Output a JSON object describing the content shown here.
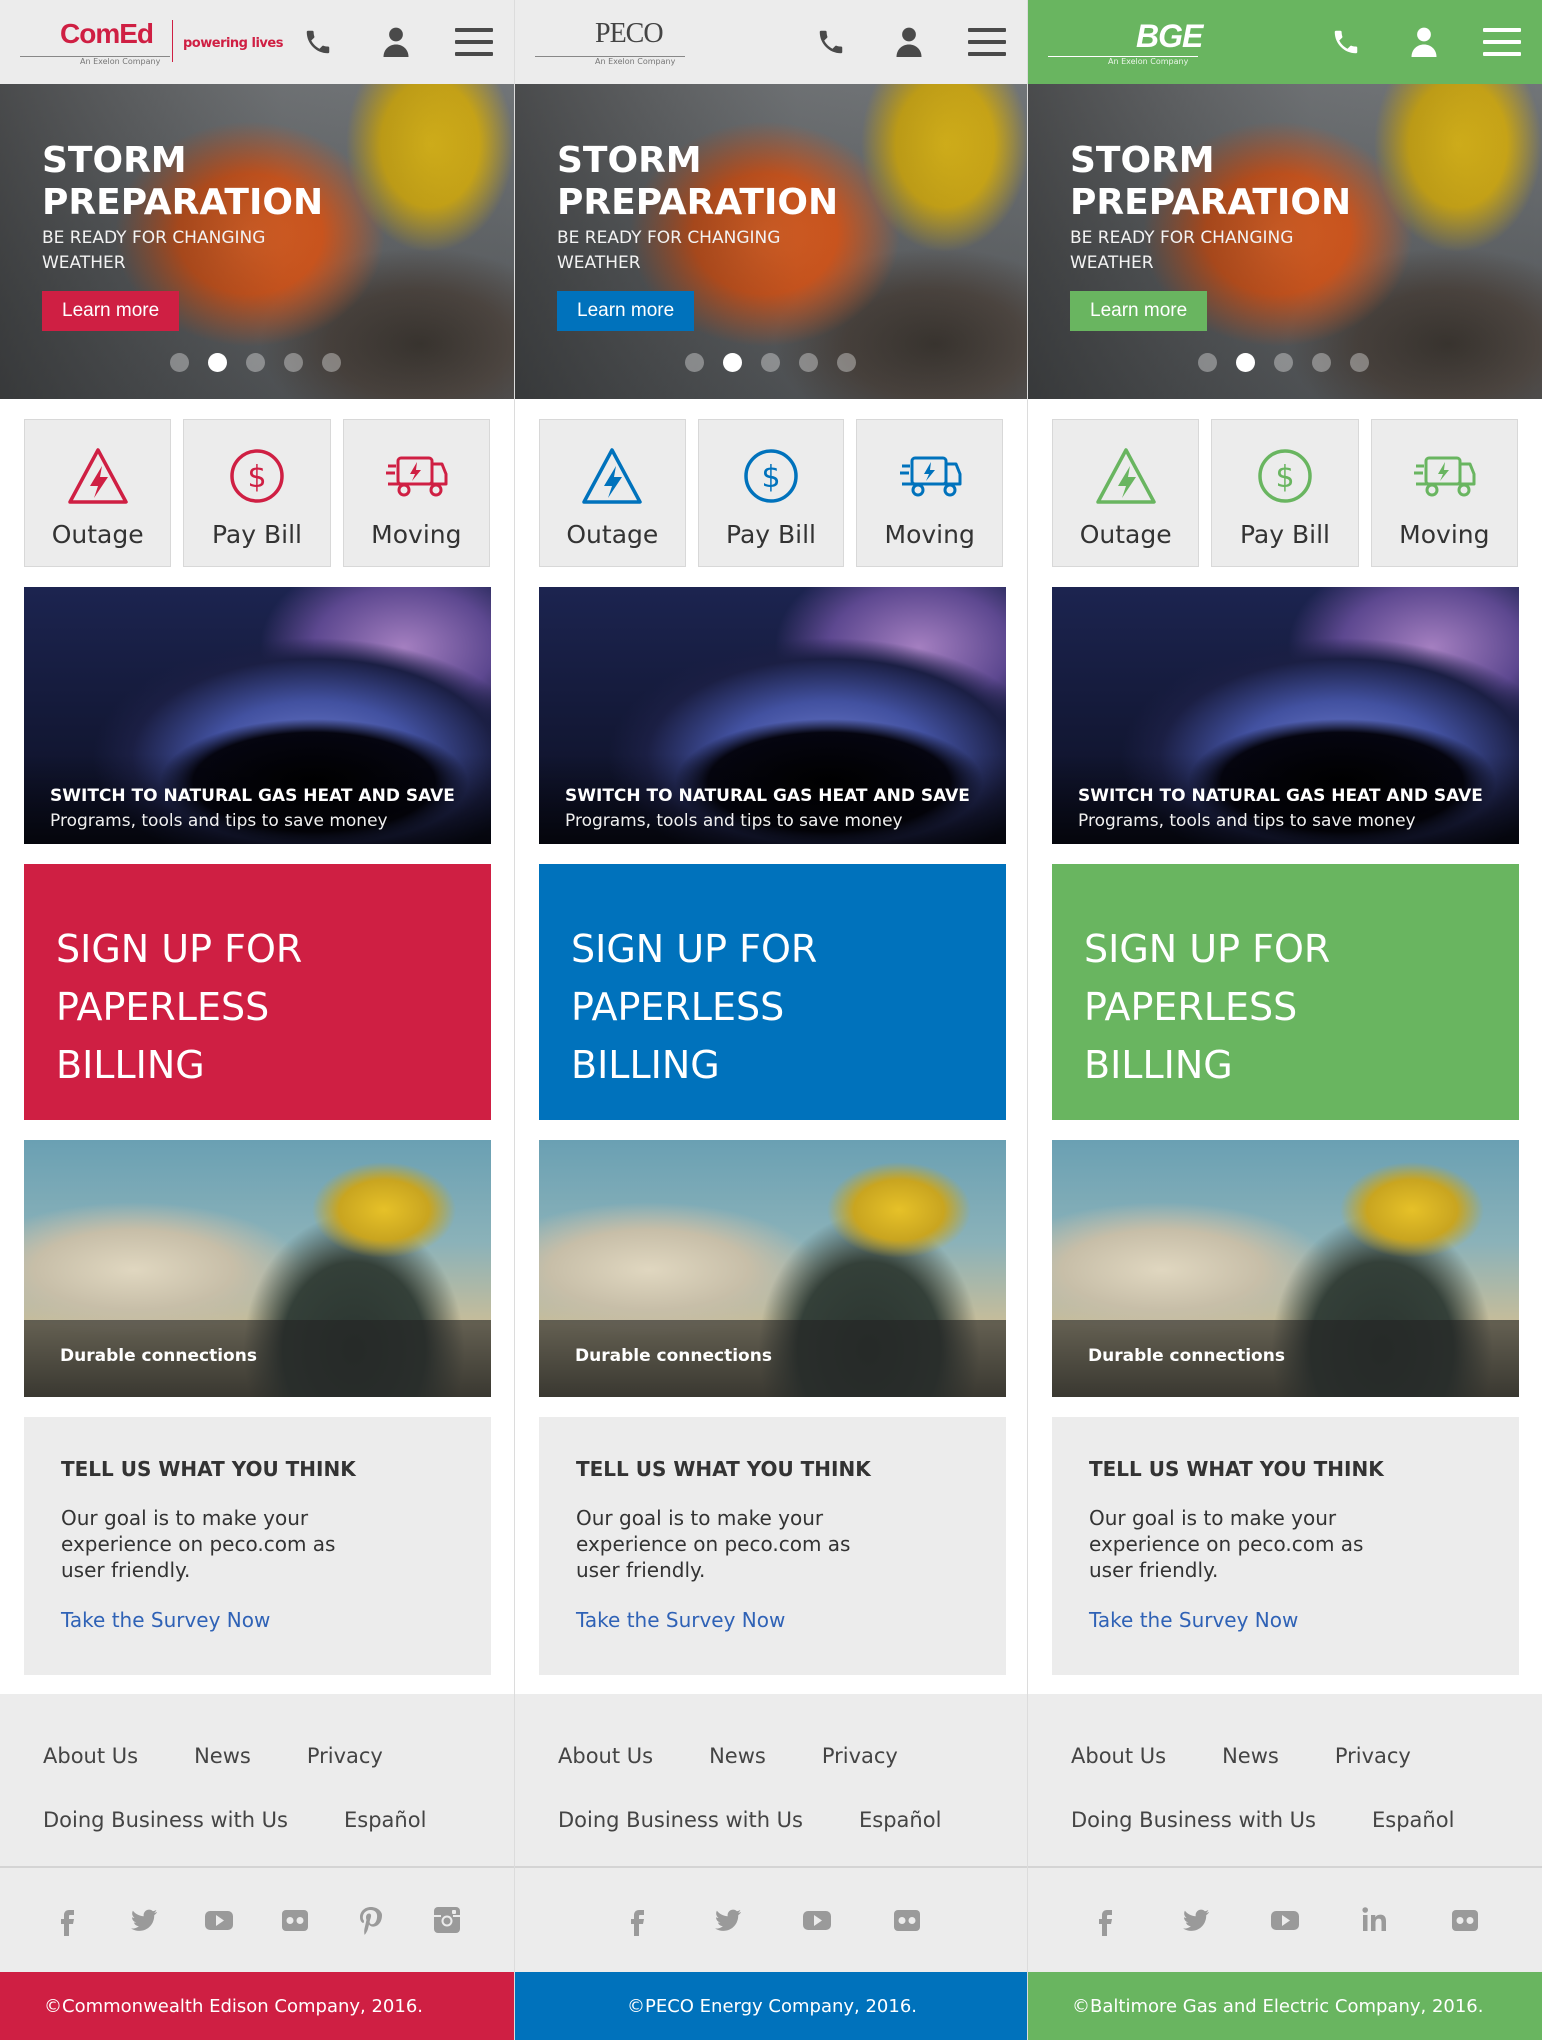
{
  "columns": [
    {
      "brand": "ComEd",
      "logo_sub": "An Exelon Company",
      "tagline": "powering lives",
      "accent": "#cf1f43",
      "header_bg": "#ececec",
      "hero": {
        "title": "STORM PREPARATION",
        "subtitle": "BE READY FOR CHANGING WEATHER",
        "button": "Learn more"
      },
      "carousel": {
        "count": 5,
        "active": 2
      },
      "tiles": [
        {
          "icon": "outage-bolt-icon",
          "label": "Outage"
        },
        {
          "icon": "dollar-icon",
          "label": "Pay Bill"
        },
        {
          "icon": "moving-truck-icon",
          "label": "Moving"
        }
      ],
      "gas_card": {
        "title": "SWITCH TO NATURAL GAS HEAT AND SAVE",
        "subtitle": "Programs, tools and tips to save money"
      },
      "paperless": {
        "text": "SIGN UP FOR PAPERLESS BILLING"
      },
      "worker_card": {
        "text": "Durable connections"
      },
      "survey": {
        "title": "TELL US WHAT YOU THINK",
        "body": "Our goal is to make your experience on peco.com as user friendly.",
        "link": "Take the Survey Now"
      },
      "footer_links": [
        [
          "About Us",
          "News",
          "Privacy"
        ],
        [
          "Doing Business with Us",
          "Español"
        ]
      ],
      "social": [
        "facebook-icon",
        "twitter-icon",
        "youtube-icon",
        "flickr-icon",
        "pinterest-icon",
        "instagram-icon"
      ],
      "copyright": "©Commonwealth Edison Company, 2016.",
      "copyright_align": "left"
    },
    {
      "brand": "PECO",
      "logo_sub": "An Exelon Company",
      "tagline": "",
      "accent": "#0072bc",
      "header_bg": "#ececec",
      "hero": {
        "title": "STORM PREPARATION",
        "subtitle": "BE READY FOR CHANGING WEATHER",
        "button": "Learn more"
      },
      "carousel": {
        "count": 5,
        "active": 2
      },
      "tiles": [
        {
          "icon": "outage-bolt-icon",
          "label": "Outage"
        },
        {
          "icon": "dollar-icon",
          "label": "Pay Bill"
        },
        {
          "icon": "moving-truck-icon",
          "label": "Moving"
        }
      ],
      "gas_card": {
        "title": "SWITCH TO NATURAL GAS HEAT AND SAVE",
        "subtitle": "Programs, tools and tips to save money"
      },
      "paperless": {
        "text": "SIGN UP FOR PAPERLESS BILLING"
      },
      "worker_card": {
        "text": "Durable connections"
      },
      "survey": {
        "title": "TELL US WHAT YOU THINK",
        "body": "Our goal is to make your experience on peco.com as user friendly.",
        "link": "Take the Survey Now"
      },
      "footer_links": [
        [
          "About Us",
          "News",
          "Privacy"
        ],
        [
          "Doing Business with Us",
          "Español"
        ]
      ],
      "social": [
        "facebook-icon",
        "twitter-icon",
        "youtube-icon",
        "flickr-icon"
      ],
      "copyright": "©PECO Energy Company, 2016.",
      "copyright_align": "center"
    },
    {
      "brand": "BGE",
      "logo_sub": "An Exelon Company",
      "tagline": "",
      "accent": "#69b560",
      "header_bg": "#69b560",
      "hero": {
        "title": "STORM PREPARATION",
        "subtitle": "BE READY FOR CHANGING WEATHER",
        "button": "Learn more"
      },
      "carousel": {
        "count": 5,
        "active": 2
      },
      "tiles": [
        {
          "icon": "outage-bolt-icon",
          "label": "Outage"
        },
        {
          "icon": "dollar-icon",
          "label": "Pay Bill"
        },
        {
          "icon": "moving-truck-icon",
          "label": "Moving"
        }
      ],
      "gas_card": {
        "title": "SWITCH TO NATURAL GAS HEAT AND SAVE",
        "subtitle": "Programs, tools and tips to save money"
      },
      "paperless": {
        "text": "SIGN UP FOR PAPERLESS BILLING"
      },
      "worker_card": {
        "text": "Durable connections"
      },
      "survey": {
        "title": "TELL US WHAT YOU THINK",
        "body": "Our goal is to make your experience on peco.com as user friendly.",
        "link": "Take the Survey Now"
      },
      "footer_links": [
        [
          "About Us",
          "News",
          "Privacy"
        ],
        [
          "Doing Business with Us",
          "Español"
        ]
      ],
      "social": [
        "facebook-icon",
        "twitter-icon",
        "youtube-icon",
        "linkedin-icon",
        "flickr-icon"
      ],
      "copyright": "©Baltimore Gas and Electric Company, 2016.",
      "copyright_align": "left"
    }
  ]
}
